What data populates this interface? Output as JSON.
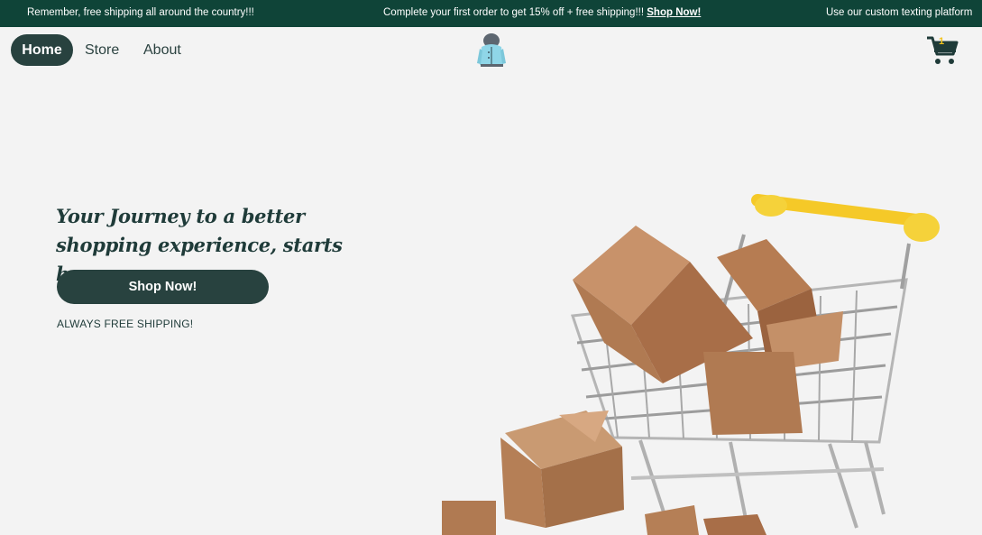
{
  "announcements": {
    "msg1": "Remember, free shipping all around the country!!!",
    "msg2": "Complete your first order to get 15% off + free shipping!!!",
    "msg2_link": "Shop Now!",
    "msg3": "Use our custom texting platform"
  },
  "nav": {
    "home": "Home",
    "store": "Store",
    "about": "About",
    "cart_count": "1"
  },
  "hero": {
    "title_line1": "Your Journey to a better",
    "title_line2": "shopping experience, starts here.",
    "button": "Shop Now!",
    "subtext": "ALWAYS FREE SHIPPING!"
  },
  "icons": {
    "logo": "jacket-logo-icon",
    "cart": "shopping-cart-icon"
  },
  "colors": {
    "brand_dark": "#28423f",
    "announce_bg": "#0f4438",
    "background": "#f3f3f3",
    "cart_handle": "#f5c928"
  }
}
